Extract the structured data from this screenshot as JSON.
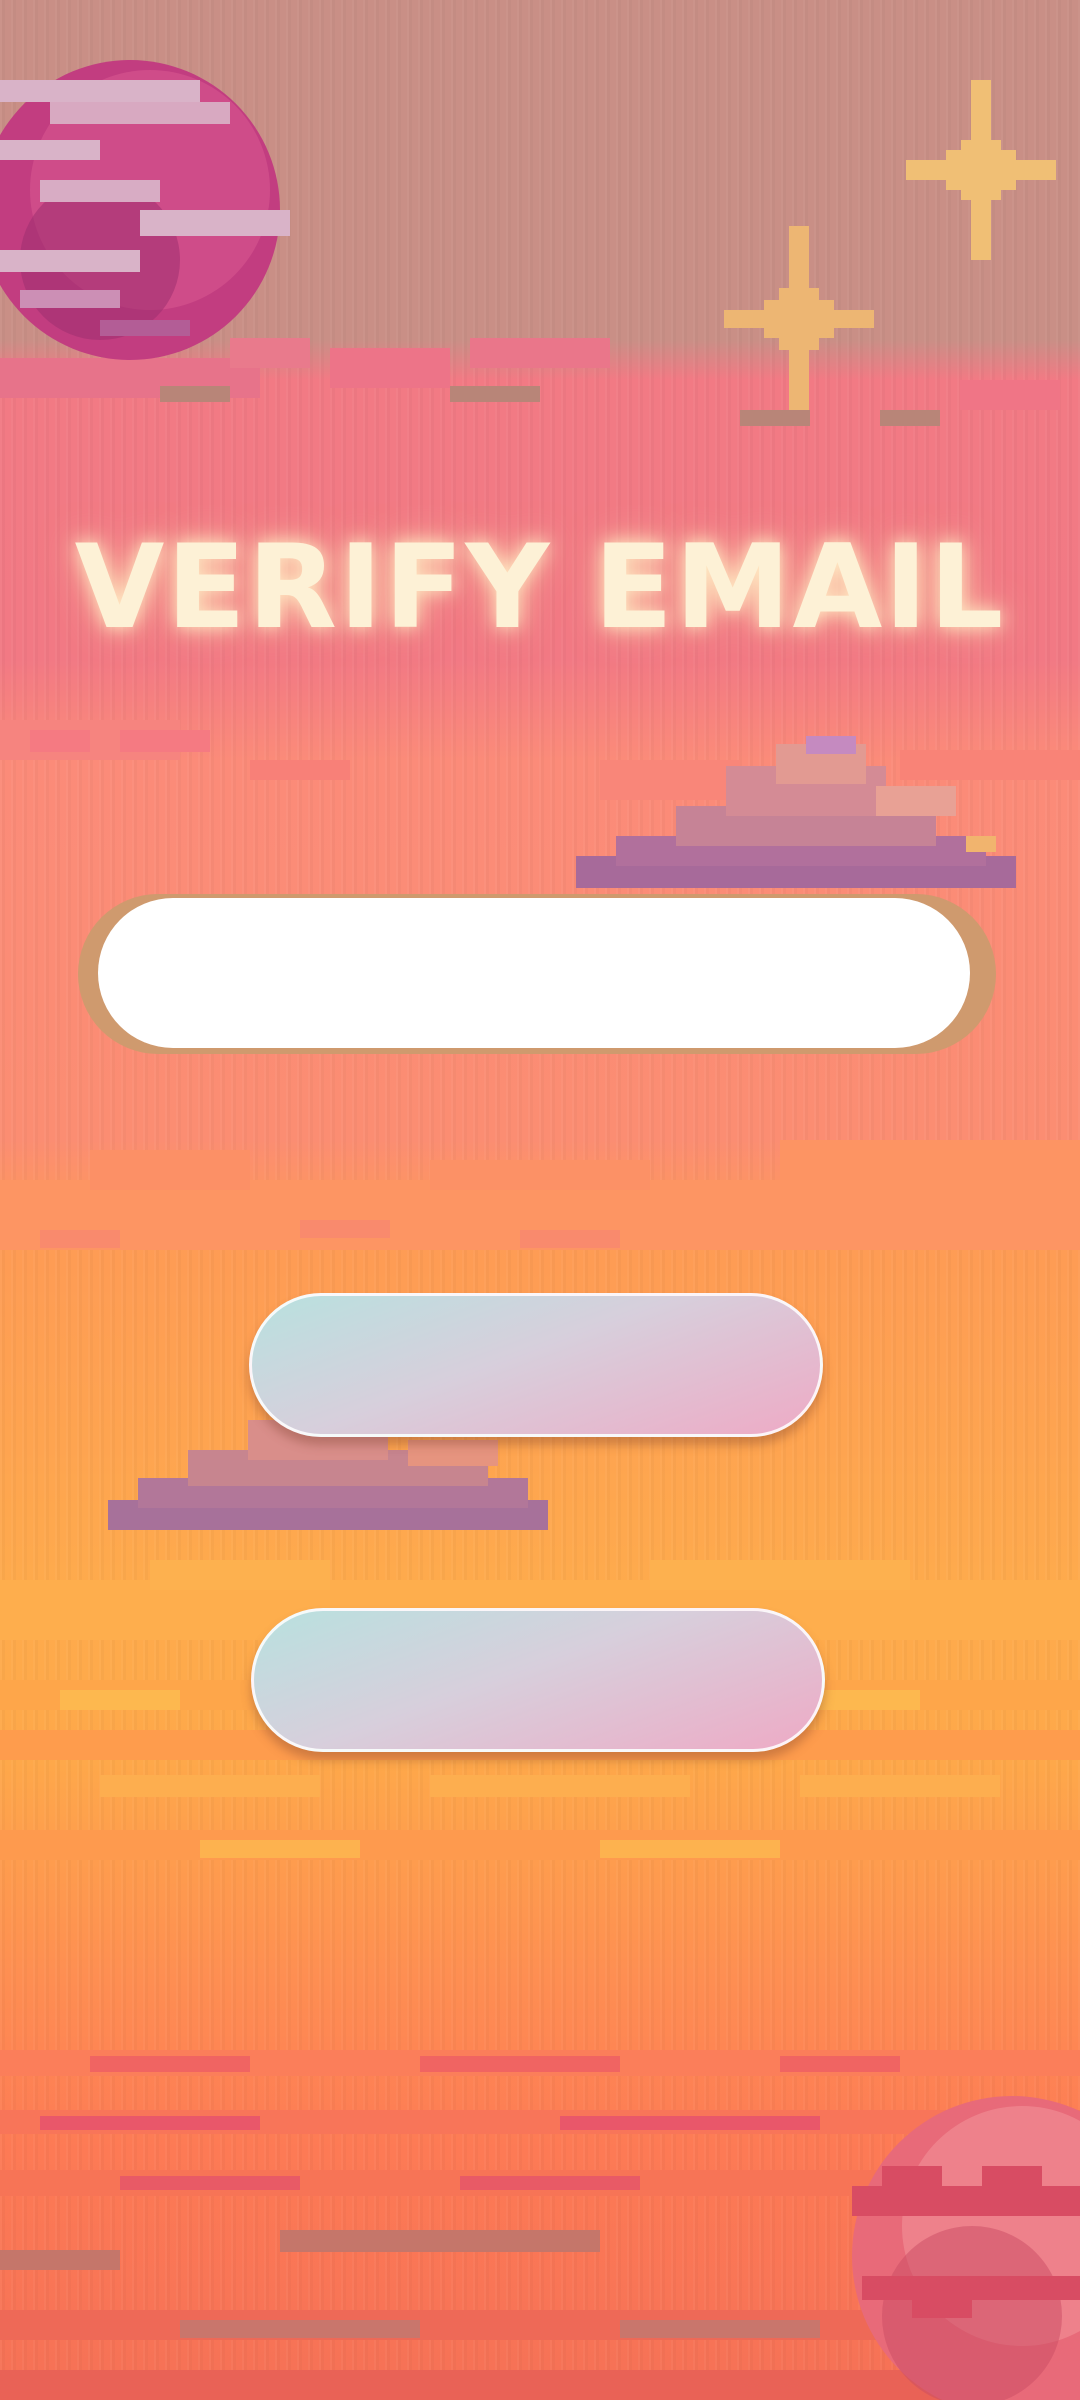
{
  "screen": {
    "title": "VERIFY EMAIL"
  },
  "email_field": {
    "value": "",
    "placeholder": ""
  },
  "buttons": {
    "primary_label": "",
    "secondary_label": ""
  },
  "decorations": {
    "icons": [
      "planet-icon",
      "sparkle-star-icon",
      "pixel-cloud-icon"
    ]
  },
  "colors": {
    "title_glow": "#fdf1d6",
    "button_gradient_start": "#b8e1df",
    "button_gradient_end": "#eeaac5",
    "input_rim": "#cf9a6e"
  }
}
